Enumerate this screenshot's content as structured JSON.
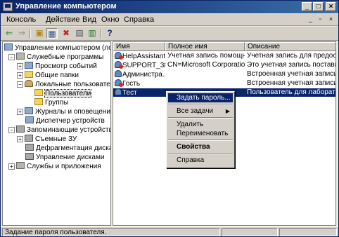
{
  "window": {
    "title": "Управление компьютером",
    "controls": {
      "minimize": "_",
      "maximize": "□",
      "close": "×"
    }
  },
  "menu": {
    "items": [
      "Консоль",
      "Действие",
      "Вид",
      "Окно",
      "Справка"
    ],
    "mdi_controls": [
      "_",
      "▫",
      "×"
    ]
  },
  "toolbar": {
    "buttons": [
      "back-icon",
      "forward-icon",
      "up-icon",
      "show-tree-icon",
      "delete-icon",
      "properties-icon",
      "refresh-icon",
      "help-icon"
    ],
    "glyphs": [
      "⇐",
      "⇒",
      "▣",
      "▦",
      "✖",
      "▤",
      "▥",
      "?"
    ]
  },
  "tree": {
    "items": [
      {
        "label": "Управление компьютером (локаль",
        "exp": "",
        "level": 0
      },
      {
        "label": "Служебные программы",
        "exp": "−",
        "level": 1
      },
      {
        "label": "Просмотр событий",
        "exp": "+",
        "level": 2
      },
      {
        "label": "Общие папки",
        "exp": "+",
        "level": 2
      },
      {
        "label": "Локальные пользователи и",
        "exp": "−",
        "level": 2
      },
      {
        "label": "Пользователи",
        "exp": "",
        "level": 3
      },
      {
        "label": "Группы",
        "exp": "",
        "level": 3
      },
      {
        "label": "Журналы и оповещения пр",
        "exp": "+",
        "level": 2
      },
      {
        "label": "Диспетчер устройств",
        "exp": "",
        "level": 2
      },
      {
        "label": "Запоминающие устройства",
        "exp": "−",
        "level": 1
      },
      {
        "label": "Съемные ЗУ",
        "exp": "+",
        "level": 2
      },
      {
        "label": "Дефрагментация диска",
        "exp": "",
        "level": 2
      },
      {
        "label": "Управление дисками",
        "exp": "",
        "level": 2
      },
      {
        "label": "Службы и приложения",
        "exp": "+",
        "level": 1
      }
    ]
  },
  "list": {
    "columns": [
      "Имя",
      "Полное имя",
      "Описание"
    ],
    "rows": [
      {
        "name": "HelpAssistant",
        "full_name": "Учетная запись помощн...",
        "description": "Учетная запись для предоставле"
      },
      {
        "name": "SUPPORT_38...",
        "full_name": "CN=Microsoft Corporation...",
        "description": "Это учетная запись поставщика"
      },
      {
        "name": "Администра...",
        "full_name": "",
        "description": "Встроенная учетная запись адми"
      },
      {
        "name": "Гость",
        "full_name": "",
        "description": "Встроенная учетная запись для д"
      },
      {
        "name": "Тест",
        "full_name": "",
        "description": "Пользователь для лабораторной"
      }
    ],
    "selected_index": 4
  },
  "context_menu": {
    "set_password": "Задать пароль...",
    "all_tasks": "Все задачи",
    "delete": "Удалить",
    "rename": "Переименовать",
    "properties": "Свойства",
    "help": "Справка",
    "submenu_arrow": "▶"
  },
  "status": {
    "text": "Задание пароля пользователя."
  },
  "colors": {
    "titlebar": "#0a246a",
    "selection": "#0a246a",
    "face": "#d4d0c8"
  }
}
